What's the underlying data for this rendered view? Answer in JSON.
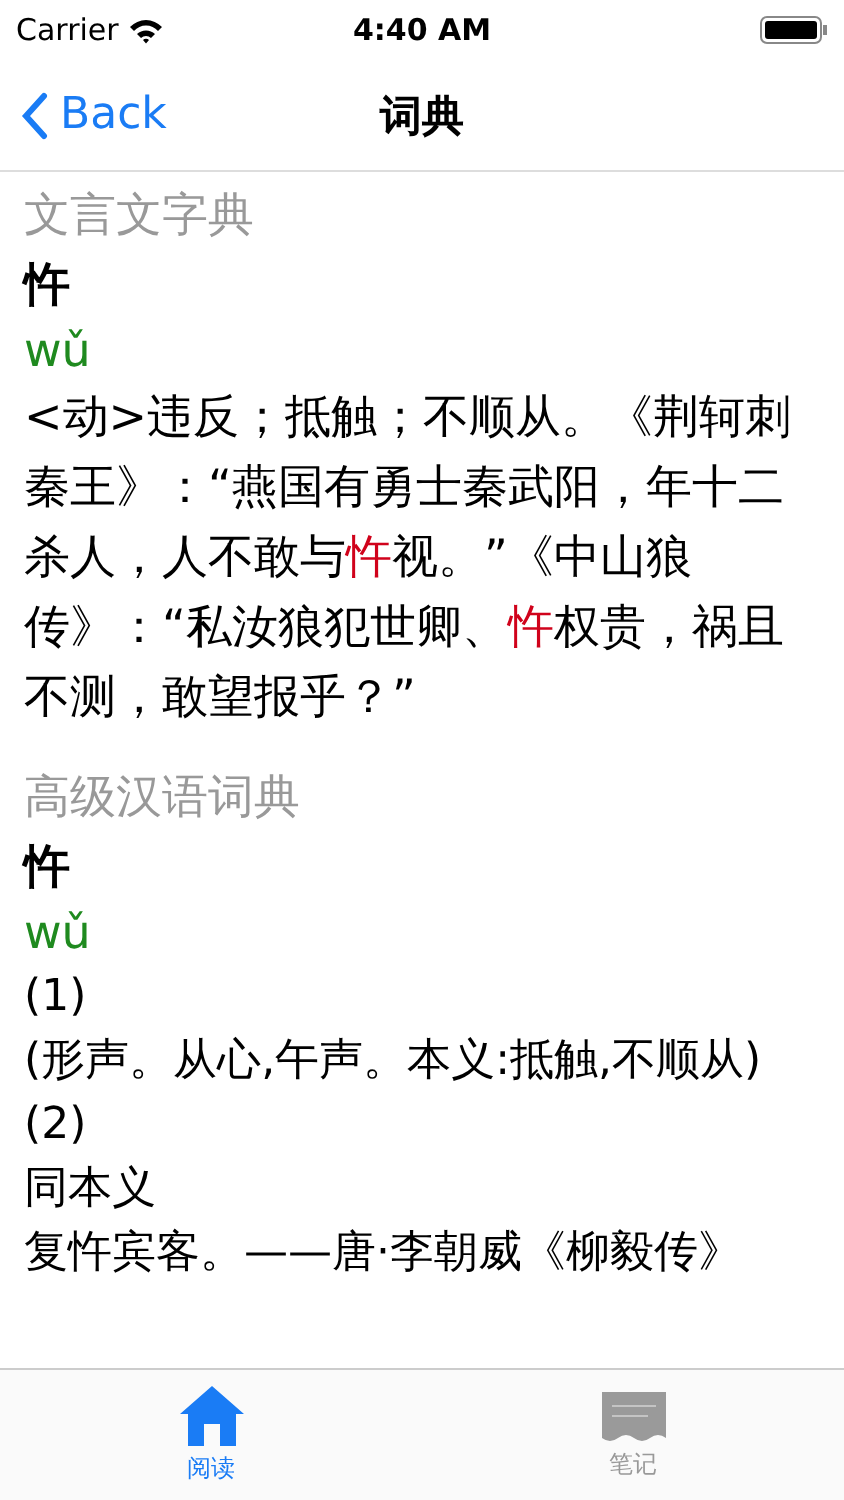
{
  "status_bar": {
    "carrier": "Carrier",
    "time": "4:40 AM"
  },
  "nav": {
    "back": "Back",
    "title": "词典"
  },
  "sections": [
    {
      "title": "文言文字典",
      "headword": "忤",
      "pinyin": "wǔ",
      "paragraphs": [
        [
          {
            "text": "<动>违反；抵触；不顺从。《荆轲刺秦王》：“燕国有勇士秦武阳，年十二杀人，人不敢与",
            "highlight": false
          },
          {
            "text": "忤",
            "highlight": true
          },
          {
            "text": "视。”《中山狼传》：“私汝狼犯世卿、",
            "highlight": false
          },
          {
            "text": "忤",
            "highlight": true
          },
          {
            "text": "权贵，祸且不测，敢望报乎？”",
            "highlight": false
          }
        ]
      ]
    },
    {
      "title": "高级汉语词典",
      "headword": "忤",
      "pinyin": "wǔ",
      "paragraphs": [
        [
          {
            "text": "(1)",
            "highlight": false
          }
        ],
        [
          {
            "text": "(形声。从心,午声。本义:抵触,不顺从)",
            "highlight": false
          }
        ],
        [
          {
            "text": "(2)",
            "highlight": false
          }
        ],
        [
          {
            "text": "同本义",
            "highlight": false
          }
        ],
        [
          {
            "text": "复忤宾客。——唐·李朝威《柳毅传》",
            "highlight": false
          }
        ]
      ]
    }
  ],
  "tabs": [
    {
      "label": "阅读",
      "kind": "home",
      "selected": true
    },
    {
      "label": "笔记",
      "kind": "notes",
      "selected": false
    }
  ]
}
